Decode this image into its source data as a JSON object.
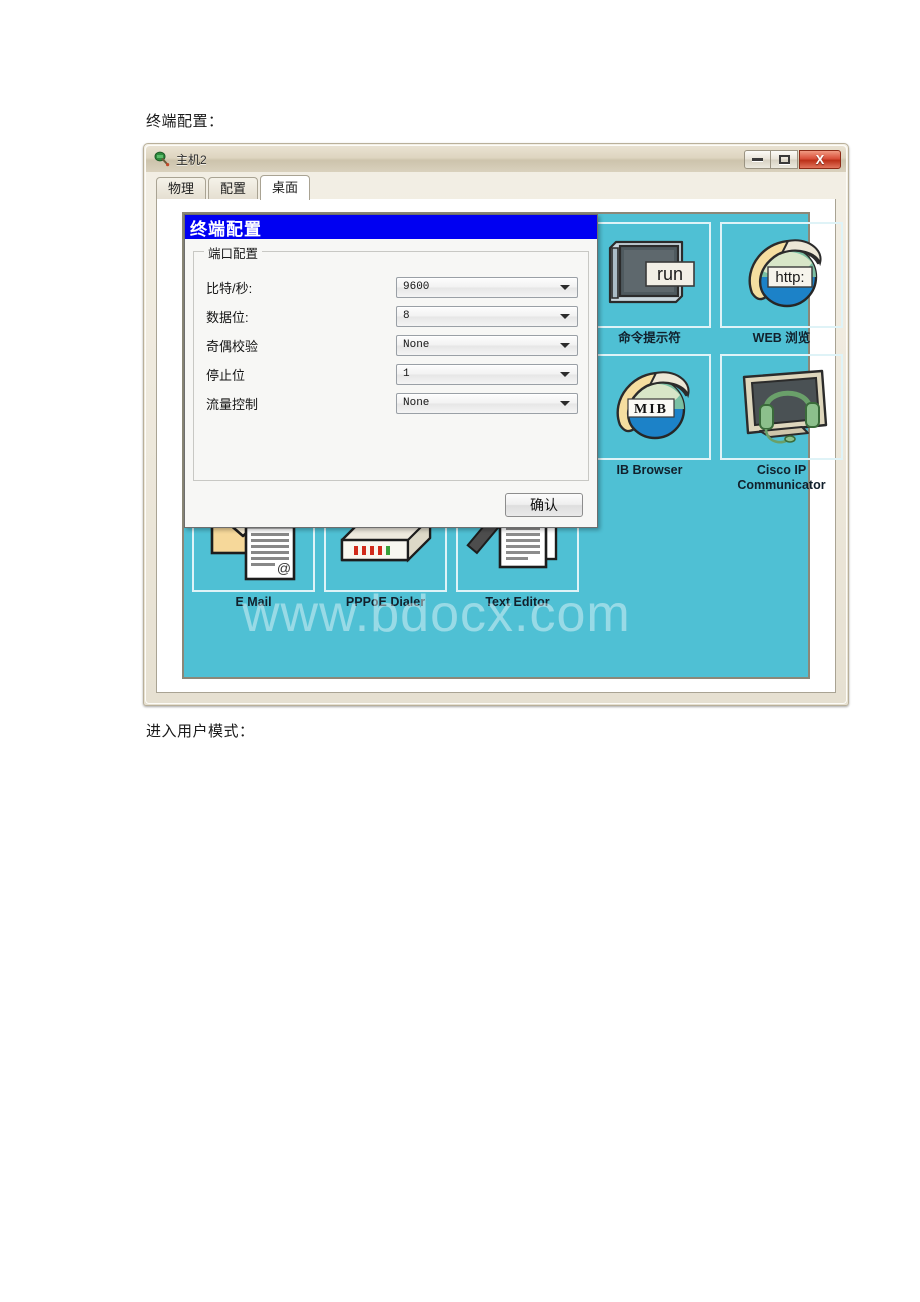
{
  "document": {
    "caption_top": "终端配置：",
    "caption_bottom": "进入用户模式："
  },
  "window": {
    "title": "主机2",
    "icon": "packet-tracer-device-icon",
    "buttons": {
      "minimize": "minimize-icon",
      "maximize": "maximize-icon",
      "close": "X"
    }
  },
  "tabs": [
    {
      "label": "物理",
      "active": false
    },
    {
      "label": "配置",
      "active": false
    },
    {
      "label": "桌面",
      "active": true
    }
  ],
  "desktop": {
    "background_color": "#4fc0d4",
    "icons": [
      {
        "name": "ip-configuration",
        "label": "",
        "icon": "ip-config-icon",
        "row": 0,
        "col": 0
      },
      {
        "name": "dial-up",
        "label": "",
        "icon": "dial-up-icon",
        "row": 0,
        "col": 1
      },
      {
        "name": "terminal",
        "label": "",
        "icon": "terminal-icon",
        "row": 0,
        "col": 2
      },
      {
        "name": "command-prompt",
        "label": "命令提示符",
        "icon": "run-monitor-icon",
        "row": 0,
        "col": 3
      },
      {
        "name": "web-browser",
        "label": "WEB 浏览",
        "icon": "http-globe-icon",
        "row": 0,
        "col": 4
      },
      {
        "name": "cisco-ip-communicator-1",
        "label": "",
        "icon": "blank-icon",
        "row": 1,
        "col": 0
      },
      {
        "name": "traffic-generator",
        "label": "",
        "icon": "blank-icon",
        "row": 1,
        "col": 1
      },
      {
        "name": "mib-browser-hidden",
        "label": "",
        "icon": "blank-icon",
        "row": 1,
        "col": 2
      },
      {
        "name": "mib-browser",
        "label": "IB Browser",
        "icon": "mib-globe-icon",
        "row": 1,
        "col": 3
      },
      {
        "name": "cisco-ip-communicator",
        "label": "Cisco IP\nCommunicator",
        "icon": "monitor-headset-icon",
        "row": 1,
        "col": 4
      },
      {
        "name": "email",
        "label": "E Mail",
        "icon": "envelope-doc-icon",
        "row": 2,
        "col": 0
      },
      {
        "name": "pppoe-dialer",
        "label": "PPPoE Dialer",
        "icon": "modem-box-icon",
        "row": 2,
        "col": 1
      },
      {
        "name": "text-editor",
        "label": "Text Editor",
        "icon": "pencil-doc-icon",
        "row": 2,
        "col": 2
      }
    ]
  },
  "terminal_dialog": {
    "title": "终端配置",
    "group_title": "端口配置",
    "fields": [
      {
        "label": "比特/秒:",
        "value": "9600"
      },
      {
        "label": "数据位:",
        "value": "8"
      },
      {
        "label": "奇偶校验",
        "value": "None"
      },
      {
        "label": "停止位",
        "value": "1"
      },
      {
        "label": "流量控制",
        "value": "None"
      }
    ],
    "confirm_label": "确认",
    "titlebar_color": "#0000f2"
  },
  "watermark": {
    "text": "www.bdocx.com"
  }
}
